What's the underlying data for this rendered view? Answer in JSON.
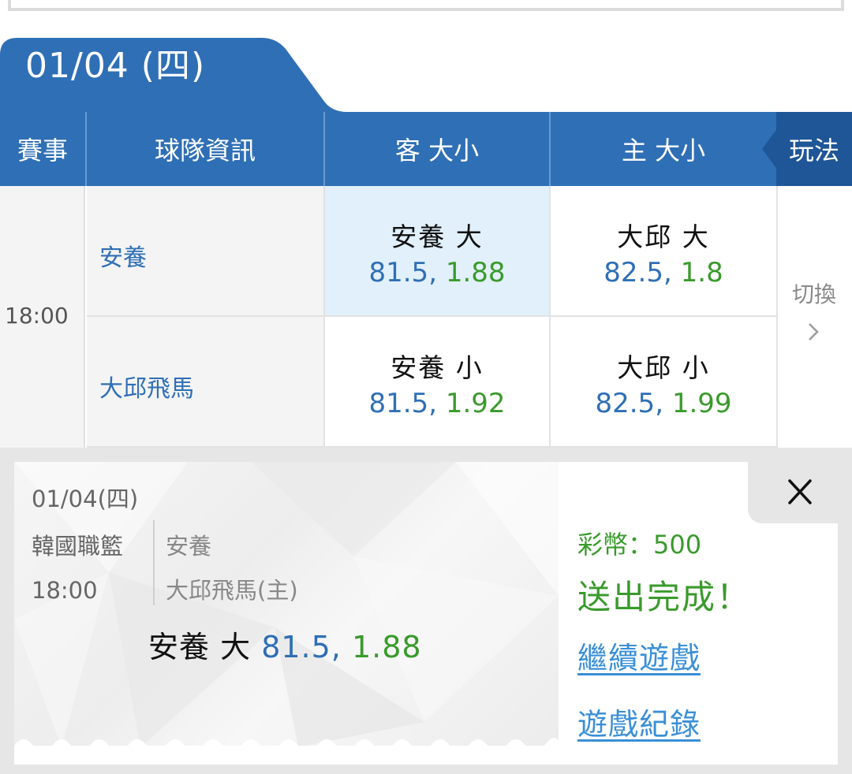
{
  "date_tab": {
    "label": "01/04 (四)"
  },
  "header": {
    "event": "賽事",
    "team_info": "球隊資訊",
    "away_ou": "客 大小",
    "home_ou": "主 大小",
    "play": "玩法"
  },
  "game": {
    "time": "18:00",
    "away_team": "安養",
    "home_team": "大邱飛馬",
    "odds": [
      {
        "label": "安養 大",
        "line": "81.5,",
        "price": "1.88",
        "selected": true
      },
      {
        "label": "大邱 大",
        "line": "82.5,",
        "price": "1.8",
        "selected": false
      },
      {
        "label": "安養 小",
        "line": "81.5,",
        "price": "1.92",
        "selected": false
      },
      {
        "label": "大邱 小",
        "line": "82.5,",
        "price": "1.99",
        "selected": false
      }
    ],
    "switch_label": "切換"
  },
  "receipt": {
    "date": "01/04(四)",
    "league": "韓國職籃",
    "time": "18:00",
    "away": "安養",
    "home": "大邱飛馬(主)",
    "bet_label": "安養 大",
    "bet_line": "81.5,",
    "bet_price": "1.88",
    "coins": "彩幣：500",
    "status": "送出完成！",
    "continue_link": "繼續遊戲",
    "history_link": "遊戲紀錄"
  },
  "colors": {
    "header_blue": "#2f6fb5",
    "play_blue": "#1f5697",
    "selected_cell": "#e1f0fb",
    "green": "#3a9a2c",
    "link_blue": "#3a8fd6"
  }
}
